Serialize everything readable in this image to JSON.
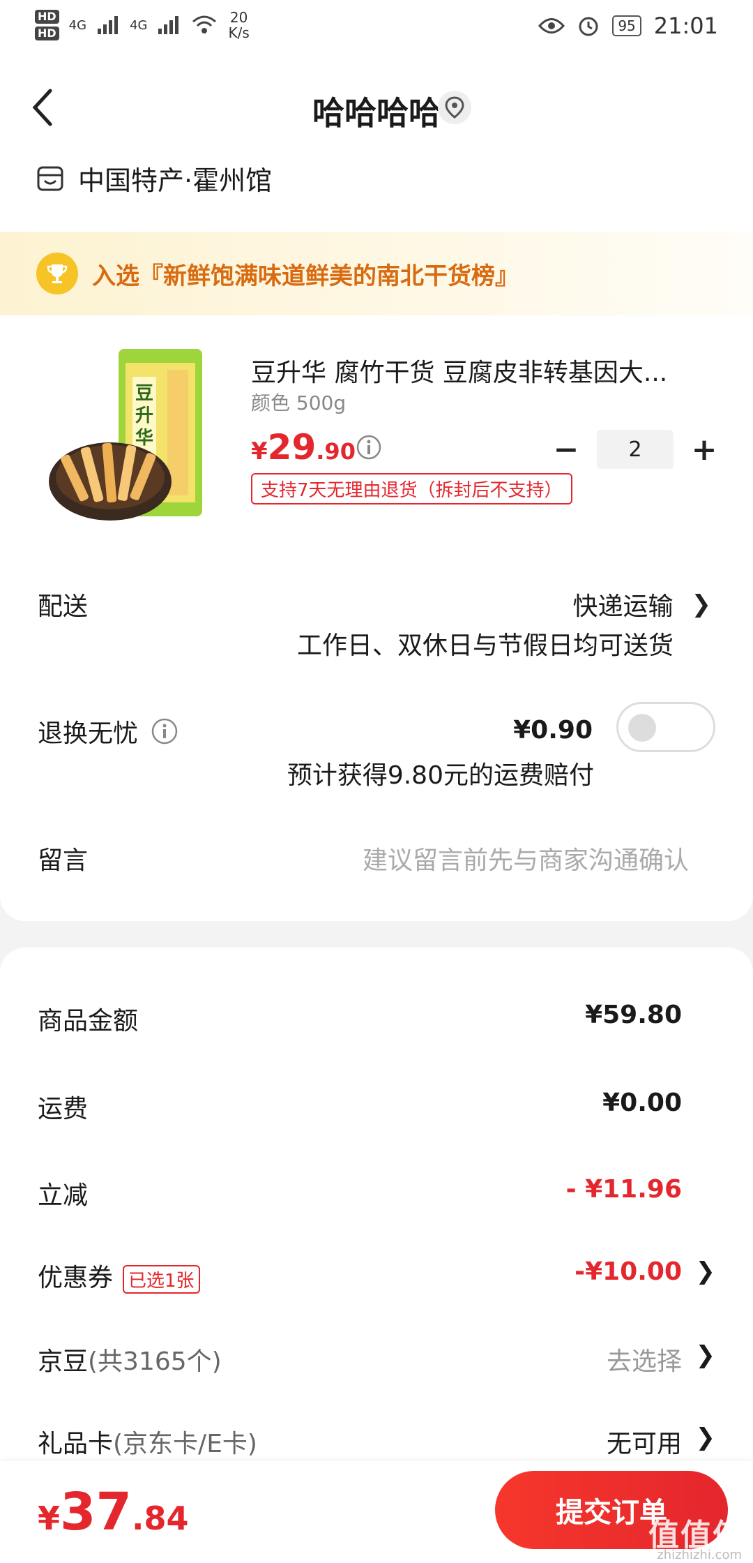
{
  "status_bar": {
    "hd1": "HD",
    "hd2": "HD",
    "network1": "4G",
    "network2": "4G",
    "speed_value": "20",
    "speed_unit": "K/s",
    "battery": "95",
    "time": "21:01"
  },
  "nav": {
    "title": "哈哈哈哈"
  },
  "shop": {
    "name": "中国特产·霍州馆"
  },
  "banner": {
    "text": "入选『新鲜饱满味道鲜美的南北干货榜』"
  },
  "product": {
    "name": "豆升华 腐竹干货 豆腐皮非转基因大...",
    "spec": "颜色 500g",
    "price_symbol": "¥",
    "price_int": "29",
    "price_dec": ".90",
    "return_policy": "支持7天无理由退货（拆封后不支持）",
    "qty_minus": "−",
    "qty": "2",
    "qty_plus": "+",
    "image_label": "豆升华"
  },
  "delivery": {
    "label": "配送",
    "value": "快递运输",
    "note": "工作日、双休日与节假日均可送货"
  },
  "exchange": {
    "label": "退换无忧",
    "price": "¥0.90",
    "note": "预计获得9.80元的运费赔付",
    "enabled": false
  },
  "message": {
    "label": "留言",
    "placeholder": "建议留言前先与商家沟通确认"
  },
  "summary": {
    "goods_label": "商品金额",
    "goods_value": "¥59.80",
    "shipping_label": "运费",
    "shipping_value": "¥0.00",
    "discount_label": "立减",
    "discount_value": "- ¥11.96",
    "coupon_label": "优惠券",
    "coupon_tag": "已选1张",
    "coupon_value": "-¥10.00",
    "jingdou_label": "京豆",
    "jingdou_sub": "(共3165个)",
    "jingdou_value": "去选择",
    "giftcard_label": "礼品卡",
    "giftcard_sub": "(京东卡/E卡)",
    "giftcard_value": "无可用"
  },
  "bottom": {
    "total_symbol": "¥",
    "total_int": "37",
    "total_dec": ".84",
    "submit_label": "提交订单",
    "watermark": "值值值",
    "watermark_sub": "zhizhizhi.com"
  },
  "colors": {
    "accent": "#e4262d",
    "banner_text": "#d86a10",
    "trophy": "#f6c426"
  }
}
